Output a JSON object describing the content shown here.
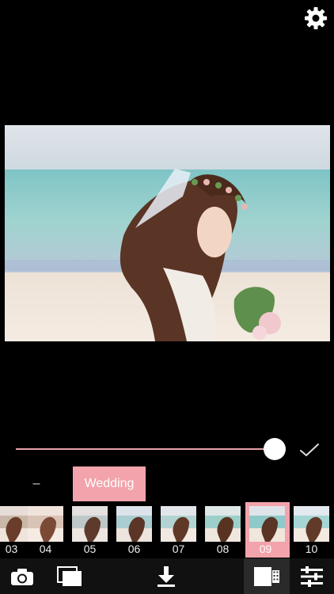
{
  "header": {
    "settings_icon": "gear-icon"
  },
  "photo": {
    "icon": "photo-preview"
  },
  "adjust": {
    "intensity": 1.0,
    "confirm_icon": "checkmark-icon"
  },
  "categories": {
    "prev_label": "–",
    "current_label": "Wedding"
  },
  "filters": [
    {
      "label": "03",
      "selected": false
    },
    {
      "label": "04",
      "selected": false
    },
    {
      "label": "05",
      "selected": false
    },
    {
      "label": "06",
      "selected": false
    },
    {
      "label": "07",
      "selected": false
    },
    {
      "label": "08",
      "selected": false
    },
    {
      "label": "09",
      "selected": true
    },
    {
      "label": "10",
      "selected": false
    }
  ],
  "toolbar": {
    "items": [
      "camera-icon",
      "gallery-icon",
      "download-icon",
      "filter-strip-icon",
      "adjust-sliders-icon"
    ]
  },
  "colors": {
    "accent": "#f3a3ab",
    "background": "#000000",
    "toolbar": "#111111"
  }
}
